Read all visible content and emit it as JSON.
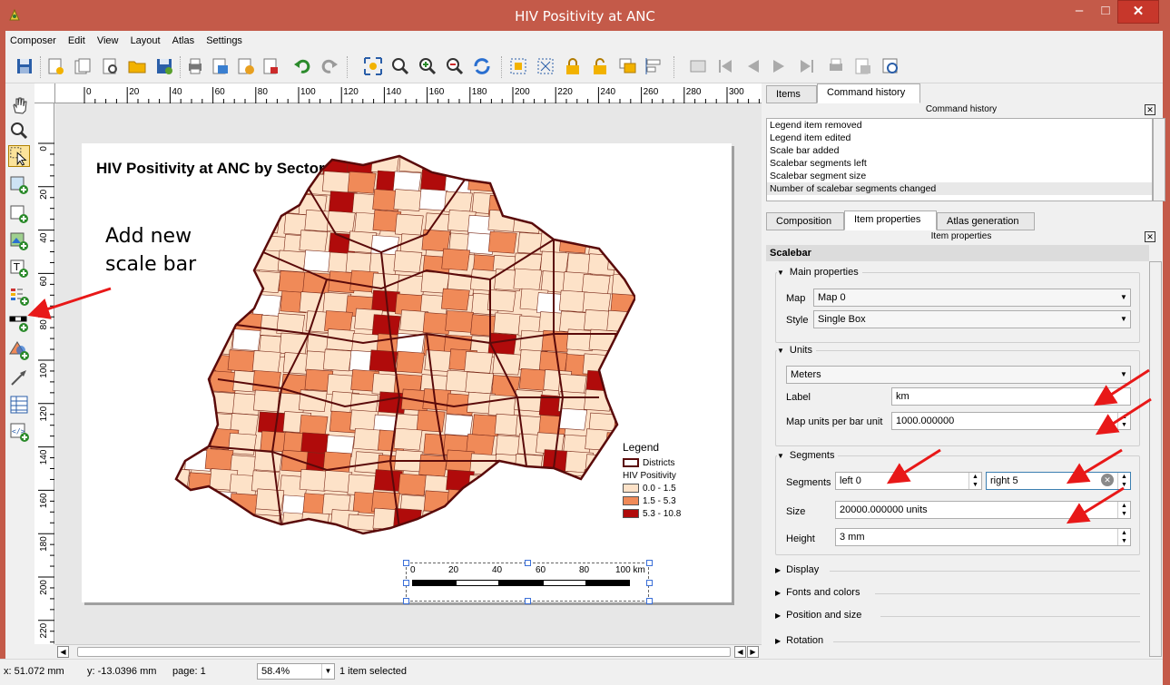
{
  "window": {
    "title": "HIV Positivity at ANC",
    "minimize": "–",
    "maximize": "□",
    "close": "✕"
  },
  "menu": [
    "Composer",
    "Edit",
    "View",
    "Layout",
    "Atlas",
    "Settings"
  ],
  "ruler": {
    "h_ticks": [
      "0",
      "20",
      "40",
      "60",
      "80",
      "100",
      "120",
      "140",
      "160",
      "180",
      "200",
      "220",
      "240",
      "260",
      "280",
      "300"
    ],
    "v_ticks": [
      "0",
      "20",
      "40",
      "60",
      "80",
      "100",
      "120",
      "140",
      "160",
      "180",
      "200",
      "220"
    ]
  },
  "annotation": {
    "line1": "Add new",
    "line2": "scale bar"
  },
  "map": {
    "title": "HIV Positivity at ANC by Sector",
    "colors": {
      "low": "#fde2c8",
      "mid": "#f08a58",
      "high": "#b00b0b",
      "border": "#5a0a0a"
    },
    "legend": {
      "title": "Legend",
      "districts": "Districts",
      "layer": "HIV Positivity",
      "classes": [
        {
          "label": "0.0 - 1.5",
          "color": "#fde2c8"
        },
        {
          "label": "1.5 - 5.3",
          "color": "#f08a58"
        },
        {
          "label": "5.3 - 10.8",
          "color": "#b00b0b"
        }
      ]
    },
    "scalebar": {
      "labels": [
        "0",
        "20",
        "40",
        "60",
        "80",
        "100 km"
      ]
    }
  },
  "panel_top": {
    "tabs": [
      "Items",
      "Command history"
    ],
    "selected_tab": "Command history",
    "header": "Command history",
    "history": [
      "Legend item removed",
      "Legend item edited",
      "Scale bar added",
      "Scalebar segments left",
      "Scalebar segment size",
      "Number of scalebar segments changed"
    ]
  },
  "panel_bottom": {
    "tabs": [
      "Composition",
      "Item properties",
      "Atlas generation"
    ],
    "selected_tab": "Item properties",
    "header": "Item properties",
    "item_heading": "Scalebar",
    "main_properties": {
      "title": "Main properties",
      "map_label": "Map",
      "map_value": "Map 0",
      "style_label": "Style",
      "style_value": "Single Box"
    },
    "units": {
      "title": "Units",
      "unit_value": "Meters",
      "label_label": "Label",
      "label_value": "km",
      "mupb_label": "Map units per bar unit",
      "mupb_value": "1000.000000"
    },
    "segments": {
      "title": "Segments",
      "segments_label": "Segments",
      "left_value": "left 0",
      "right_value": "right 5",
      "size_label": "Size",
      "size_value": "20000.000000 units",
      "height_label": "Height",
      "height_value": "3 mm"
    },
    "collapsed": [
      "Display",
      "Fonts and colors",
      "Position and size",
      "Rotation"
    ]
  },
  "status": {
    "x": "x: 51.072 mm",
    "y": "y: -13.0396 mm",
    "page": "page: 1",
    "zoom": "58.4%",
    "selection": "1 item selected"
  }
}
